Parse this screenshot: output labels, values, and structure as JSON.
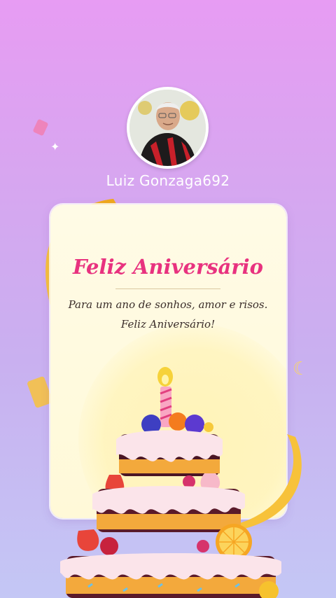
{
  "profile": {
    "username": "Luiz Gonzaga692",
    "avatar_icon": "person-photo-icon"
  },
  "card": {
    "title": "Feliz Aniversário",
    "message_line1": "Para um ano de sonhos, amor e risos.",
    "message_line2": "Feliz Aniversário!"
  },
  "colors": {
    "background_top": "#e79cf3",
    "background_bottom": "#c4c7f5",
    "title": "#e8327f",
    "card": "#fffbe6",
    "ribbon": "#f7c23a"
  }
}
